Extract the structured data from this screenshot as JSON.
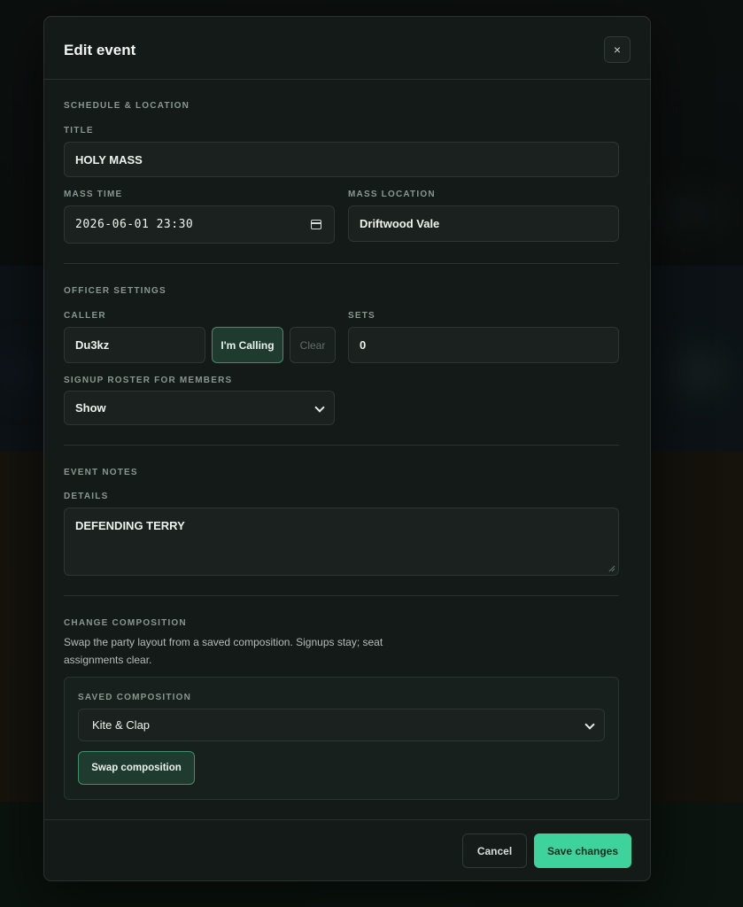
{
  "modal": {
    "title": "Edit event",
    "close_label": "×"
  },
  "schedule": {
    "section_label": "SCHEDULE & LOCATION",
    "title_label": "TITLE",
    "title_value": "HOLY MASS",
    "mass_time_label": "MASS TIME",
    "mass_time_value": "2026-06-01 23:30",
    "mass_location_label": "MASS LOCATION",
    "mass_location_value": "Driftwood Vale"
  },
  "officer": {
    "section_label": "OFFICER SETTINGS",
    "caller_label": "CALLER",
    "caller_value": "Du3kz",
    "im_calling_label": "I'm Calling",
    "clear_label": "Clear",
    "sets_label": "SETS",
    "sets_value": "0",
    "roster_label": "SIGNUP ROSTER FOR MEMBERS",
    "roster_value": "Show"
  },
  "notes": {
    "section_label": "EVENT NOTES",
    "details_label": "DETAILS",
    "details_value": "DEFENDING TERRY"
  },
  "composition": {
    "section_label": "CHANGE COMPOSITION",
    "help_line1": "Swap the party layout from a saved composition. Signups stay; seat",
    "help_line2": "assignments clear.",
    "saved_label": "SAVED COMPOSITION",
    "saved_value": "Kite & Clap",
    "swap_label": "Swap composition"
  },
  "footer": {
    "cancel_label": "Cancel",
    "save_label": "Save changes"
  },
  "colors": {
    "accent": "#3ed39c",
    "modal_bg": "#141a18",
    "input_bg": "#1a211e"
  },
  "icons": {
    "close": "close-icon",
    "calendar": "calendar-icon",
    "dropdown": "chevron-down-icon"
  }
}
